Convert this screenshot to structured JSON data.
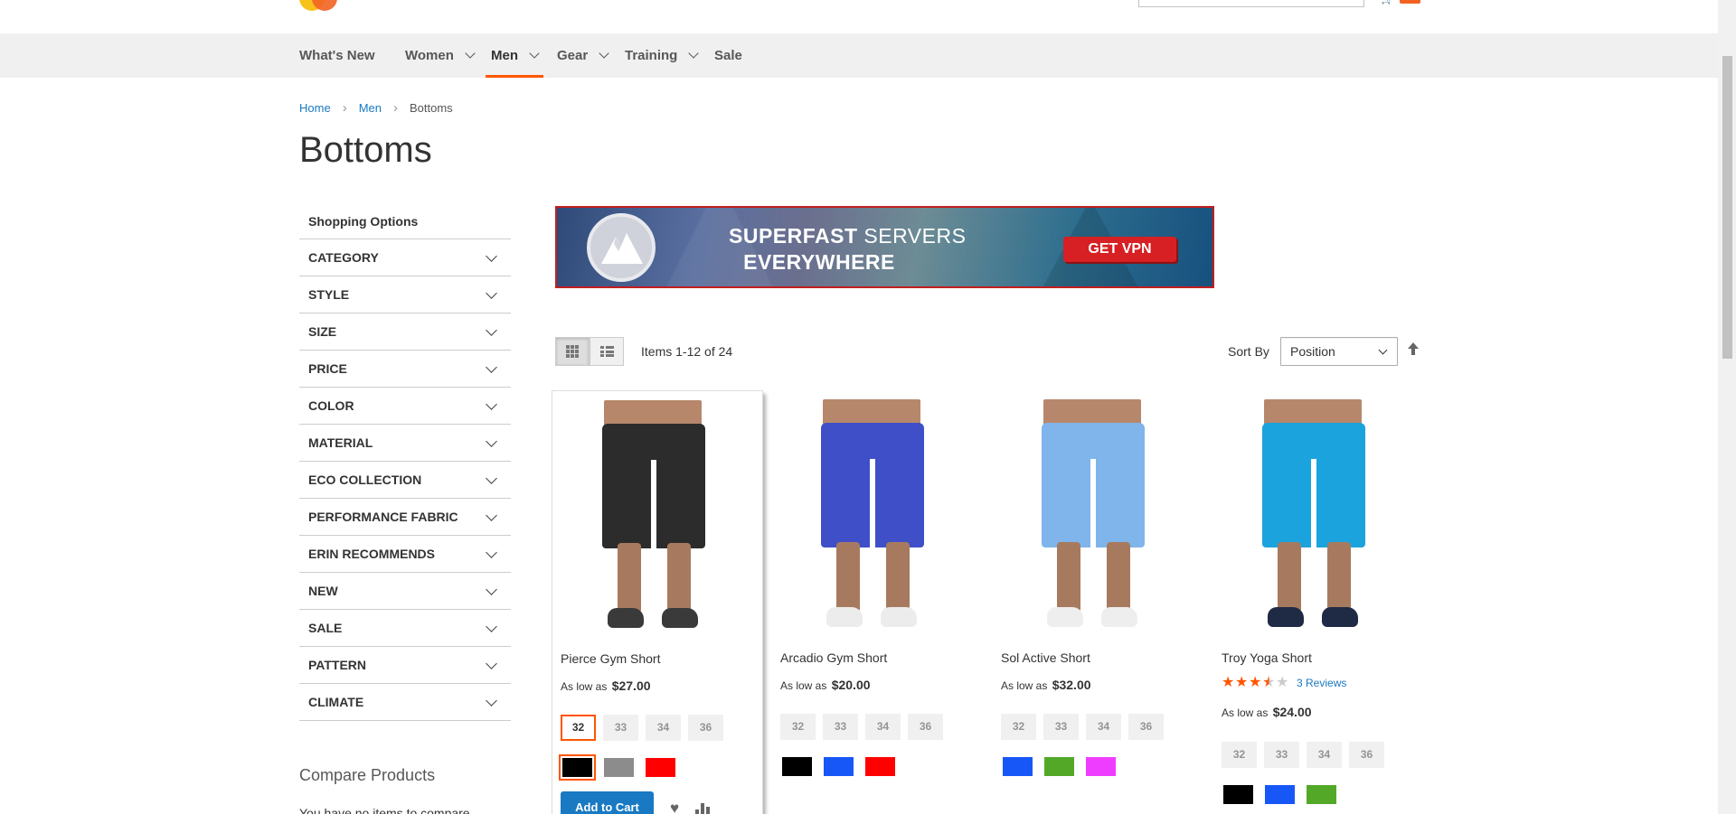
{
  "nav": {
    "items": [
      {
        "label": "What's New"
      },
      {
        "label": "Women"
      },
      {
        "label": "Men"
      },
      {
        "label": "Gear"
      },
      {
        "label": "Training"
      },
      {
        "label": "Sale"
      }
    ],
    "active": "Men"
  },
  "breadcrumb": {
    "home": "Home",
    "parent": "Men",
    "current": "Bottoms"
  },
  "page_title": "Bottoms",
  "sidebar": {
    "title": "Shopping Options",
    "filters": [
      "CATEGORY",
      "STYLE",
      "SIZE",
      "PRICE",
      "COLOR",
      "MATERIAL",
      "ECO COLLECTION",
      "PERFORMANCE FABRIC",
      "ERIN RECOMMENDS",
      "NEW",
      "SALE",
      "PATTERN",
      "CLIMATE"
    ],
    "compare_title": "Compare Products",
    "compare_empty": "You have no items to compare."
  },
  "banner": {
    "line1_bold": "SUPERFAST",
    "line1_thin": "SERVERS",
    "line2": "EVERYWHERE",
    "button": "GET VPN"
  },
  "toolbar": {
    "items_count": "Items 1-12 of 24",
    "sort_label": "Sort By",
    "sort_value": "Position"
  },
  "products": [
    {
      "name": "Pierce Gym Short",
      "price_prefix": "As low as",
      "price": "$27.00",
      "sizes": [
        "32",
        "33",
        "34",
        "36"
      ],
      "selected_size": "32",
      "colors": [
        "#000000",
        "#8c8c8c",
        "#ff0000"
      ],
      "selected_color": 0,
      "short_color": "#2c2c2c",
      "shoe_color": "#3a3a3a",
      "add_to_cart": "Add to Cart"
    },
    {
      "name": "Arcadio Gym Short",
      "price_prefix": "As low as",
      "price": "$20.00",
      "sizes": [
        "32",
        "33",
        "34",
        "36"
      ],
      "colors": [
        "#000000",
        "#1857f7",
        "#ff0000"
      ],
      "short_color": "#3f4fc8",
      "shoe_color": "#ececec"
    },
    {
      "name": "Sol Active Short",
      "price_prefix": "As low as",
      "price": "$32.00",
      "sizes": [
        "32",
        "33",
        "34",
        "36"
      ],
      "colors": [
        "#1857f7",
        "#53a828",
        "#ef3dff"
      ],
      "short_color": "#7fb5ea",
      "shoe_color": "#eeeeee"
    },
    {
      "name": "Troy Yoga Short",
      "rating": 3.5,
      "reviews": "3 Reviews",
      "price_prefix": "As low as",
      "price": "$24.00",
      "sizes": [
        "32",
        "33",
        "34",
        "36"
      ],
      "colors": [
        "#000000",
        "#1857f7",
        "#53a828"
      ],
      "short_color": "#1ba3dd",
      "shoe_color": "#1f2a44"
    }
  ],
  "colors": {
    "accent": "#ff5501",
    "link": "#1979c3",
    "nav_bg": "#f0f0f0"
  }
}
